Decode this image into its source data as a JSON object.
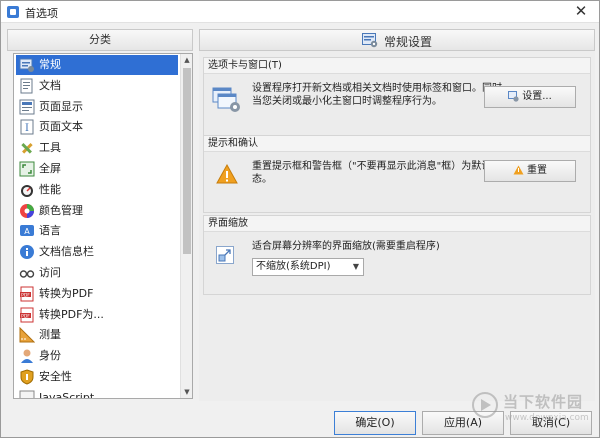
{
  "window": {
    "title": "首选项",
    "close_glyph": "✕"
  },
  "left": {
    "header": "分类",
    "items": [
      {
        "label": "常规",
        "icon": "general-settings-icon",
        "selected": true
      },
      {
        "label": "文档",
        "icon": "document-icon"
      },
      {
        "label": "页面显示",
        "icon": "page-display-icon"
      },
      {
        "label": "页面文本",
        "icon": "page-text-icon"
      },
      {
        "label": "工具",
        "icon": "tools-icon"
      },
      {
        "label": "全屏",
        "icon": "fullscreen-icon"
      },
      {
        "label": "性能",
        "icon": "performance-icon"
      },
      {
        "label": "颜色管理",
        "icon": "color-management-icon"
      },
      {
        "label": "语言",
        "icon": "language-icon"
      },
      {
        "label": "文档信息栏",
        "icon": "info-bar-icon"
      },
      {
        "label": "访问",
        "icon": "accessibility-icon"
      },
      {
        "label": "转换为PDF",
        "icon": "convert-to-pdf-icon"
      },
      {
        "label": "转换PDF为...",
        "icon": "convert-pdf-to-icon"
      },
      {
        "label": "测量",
        "icon": "measure-icon"
      },
      {
        "label": "身份",
        "icon": "identity-icon"
      },
      {
        "label": "安全性",
        "icon": "security-icon"
      },
      {
        "label": "JavaScript",
        "icon": "javascript-icon"
      }
    ]
  },
  "right": {
    "header": "常规设置",
    "tabs_group": {
      "title": "选项卡与窗口(T)",
      "desc_line1": "设置程序打开新文档或相关文档时使用标签和窗口。同时",
      "desc_line2": "当您关闭或最小化主窗口时调整程序行为。",
      "button": "设置..."
    },
    "prompt_group": {
      "title": "提示和确认",
      "desc_line1": "重置提示框和警告框（\"不要再显示此消息\"框）为默认状",
      "desc_line2": "态。",
      "button": "重置"
    },
    "zoom_group": {
      "title": "界面缩放",
      "desc": "适合屏幕分辨率的界面缩放(需要重启程序)",
      "select_value": "不缩放(系统DPI)"
    }
  },
  "footer": {
    "ok": "确定(O)",
    "apply": "应用(A)",
    "cancel": "取消(C)"
  },
  "watermark": {
    "text": "当下软件园",
    "sub": "www.downxia.com"
  },
  "colors": {
    "selection": "#2f6fd4",
    "warning": "#f0a020",
    "accent": "#3a7bd5"
  }
}
